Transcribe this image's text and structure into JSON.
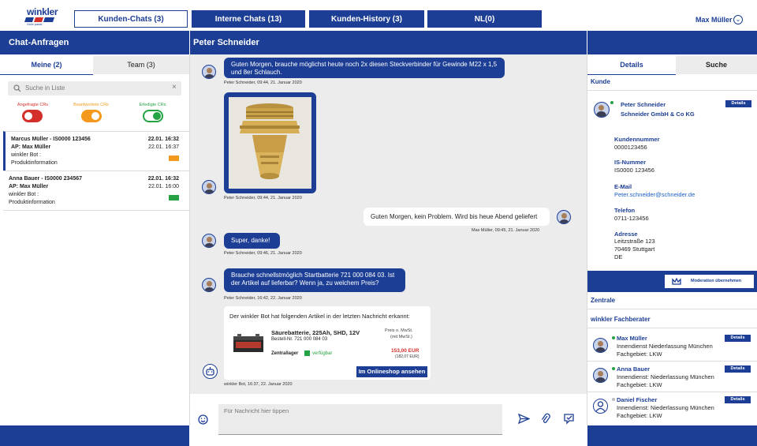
{
  "brand": {
    "logo_text": "winkler",
    "logo_tagline": "Gute passt."
  },
  "tabs": [
    {
      "label": "Kunden-Chats (3)"
    },
    {
      "label": "Interne Chats (13)"
    },
    {
      "label": "Kunden-History (3)"
    },
    {
      "label": "NL(0)"
    }
  ],
  "user": {
    "name": "Max Müller"
  },
  "left": {
    "title": "Chat-Anfragen",
    "subtabs": [
      "Meine (2)",
      "Team (3)"
    ],
    "search_placeholder": "Suche in Liste",
    "toggles": [
      {
        "label": "Angefragte CRs",
        "color": "#d3302b"
      },
      {
        "label": "Beantwortete CRs",
        "color": "#f39a1e"
      },
      {
        "label": "Erledigte CRs",
        "color": "#25a244"
      }
    ],
    "items": [
      {
        "name": "Marcus Müller - IS0000 123456",
        "ap": "AP: Max Müller",
        "date": "22.01. 16:32",
        "time": "22.01. 16:37",
        "bot": "winkler Bot :",
        "topic": "Produktinformation",
        "status_color": "#f39a1e"
      },
      {
        "name": "Anna Bauer - IS0000 234567",
        "ap": "AP: Max Müller",
        "date": "22.01. 16:32",
        "time": "22.01. 16:00",
        "bot": "winkler Bot :",
        "topic": "Produktinformation",
        "status_color": "#25a244"
      }
    ]
  },
  "chat": {
    "title": "Peter Schneider",
    "messages": [
      {
        "text": "Guten Morgen, brauche möglichst heute noch 2x diesen Steckverbinder für Gewinde M22 x 1,5 und 8er Schlauch.",
        "meta": "Peter Schneider, 09:44, 21. Januar 2020"
      },
      {
        "meta": "Peter Schneider, 09:44, 21. Januar 2020"
      },
      {
        "text": "Guten Morgen, kein Problem. Wird bis heue Abend geliefert",
        "meta": "Max Müller, 09:45, 21. Januar 2020"
      },
      {
        "text": "Super, danke!",
        "meta": "Peter Schneider, 09:46, 21. Januar 2020"
      },
      {
        "text": "Brauche schnellstmöglich Startbatterie 721 000 084 03. Ist der Artikel auf lieferbar? Wenn ja, zu welchem Preis?",
        "meta": "Peter Schneider, 16:42, 22. Januar 2020"
      }
    ],
    "bot_card": {
      "intro": "Der winkler Bot hat folgenden Artikel in der letzten Nachricht erkannt:",
      "product": "Säurebatterie, 225Ah, SHD, 12V",
      "order_no": "Bestell-Nr. 721 000 084 03",
      "price_label_1": "Preis o. MwSt.",
      "price_label_2": "(mit MwSt.)",
      "stock_label": "Zentrallager",
      "stock_status": "verfügbar",
      "price": "153,00 EUR",
      "price_gross": "(182,07 EUR)",
      "button": "Im Onlineshop ansehen",
      "meta": "winkler Bot, 16:37, 22. Januar 2020"
    },
    "input_placeholder": "Für Nachricht hier tippen"
  },
  "right": {
    "tabs": [
      "Details",
      "Suche"
    ],
    "kunde_heading": "Kunde",
    "customer": {
      "name": "Peter Schneider",
      "company": "Schneider GmbH & Co KG",
      "button": "Details"
    },
    "fields": [
      {
        "label": "Kundennummer",
        "value": "0000123456"
      },
      {
        "label": "IS-Nummer",
        "value": "IS0000 123456"
      },
      {
        "label": "E-Mail",
        "value": "Peter.schneider@schneider.de"
      },
      {
        "label": "Telefon",
        "value": "0711-123456"
      },
      {
        "label": "Adresse",
        "value": "Leitzstraße 123"
      }
    ],
    "address_lines": [
      "70469 Stuttgart",
      "DE"
    ],
    "moderation_button": "Moderation übernehmen",
    "zentrale_heading": "Zentrale",
    "berater_heading": "winkler Fachberater",
    "berater": [
      {
        "name": "Max Müller",
        "line1": "Innendienst Niederlassung München",
        "line2": "Fachgebiet: LKW",
        "button": "Details"
      },
      {
        "name": "Anna Bauer",
        "line1": "Innendienst: Niederlassung München",
        "line2": "Fachgebiet: LKW",
        "button": "Details"
      },
      {
        "name": "Daniel Fischer",
        "line1": "Innendienst: Niederlassung München",
        "line2": "Fachgebiet: LKW",
        "button": "Details"
      }
    ]
  }
}
